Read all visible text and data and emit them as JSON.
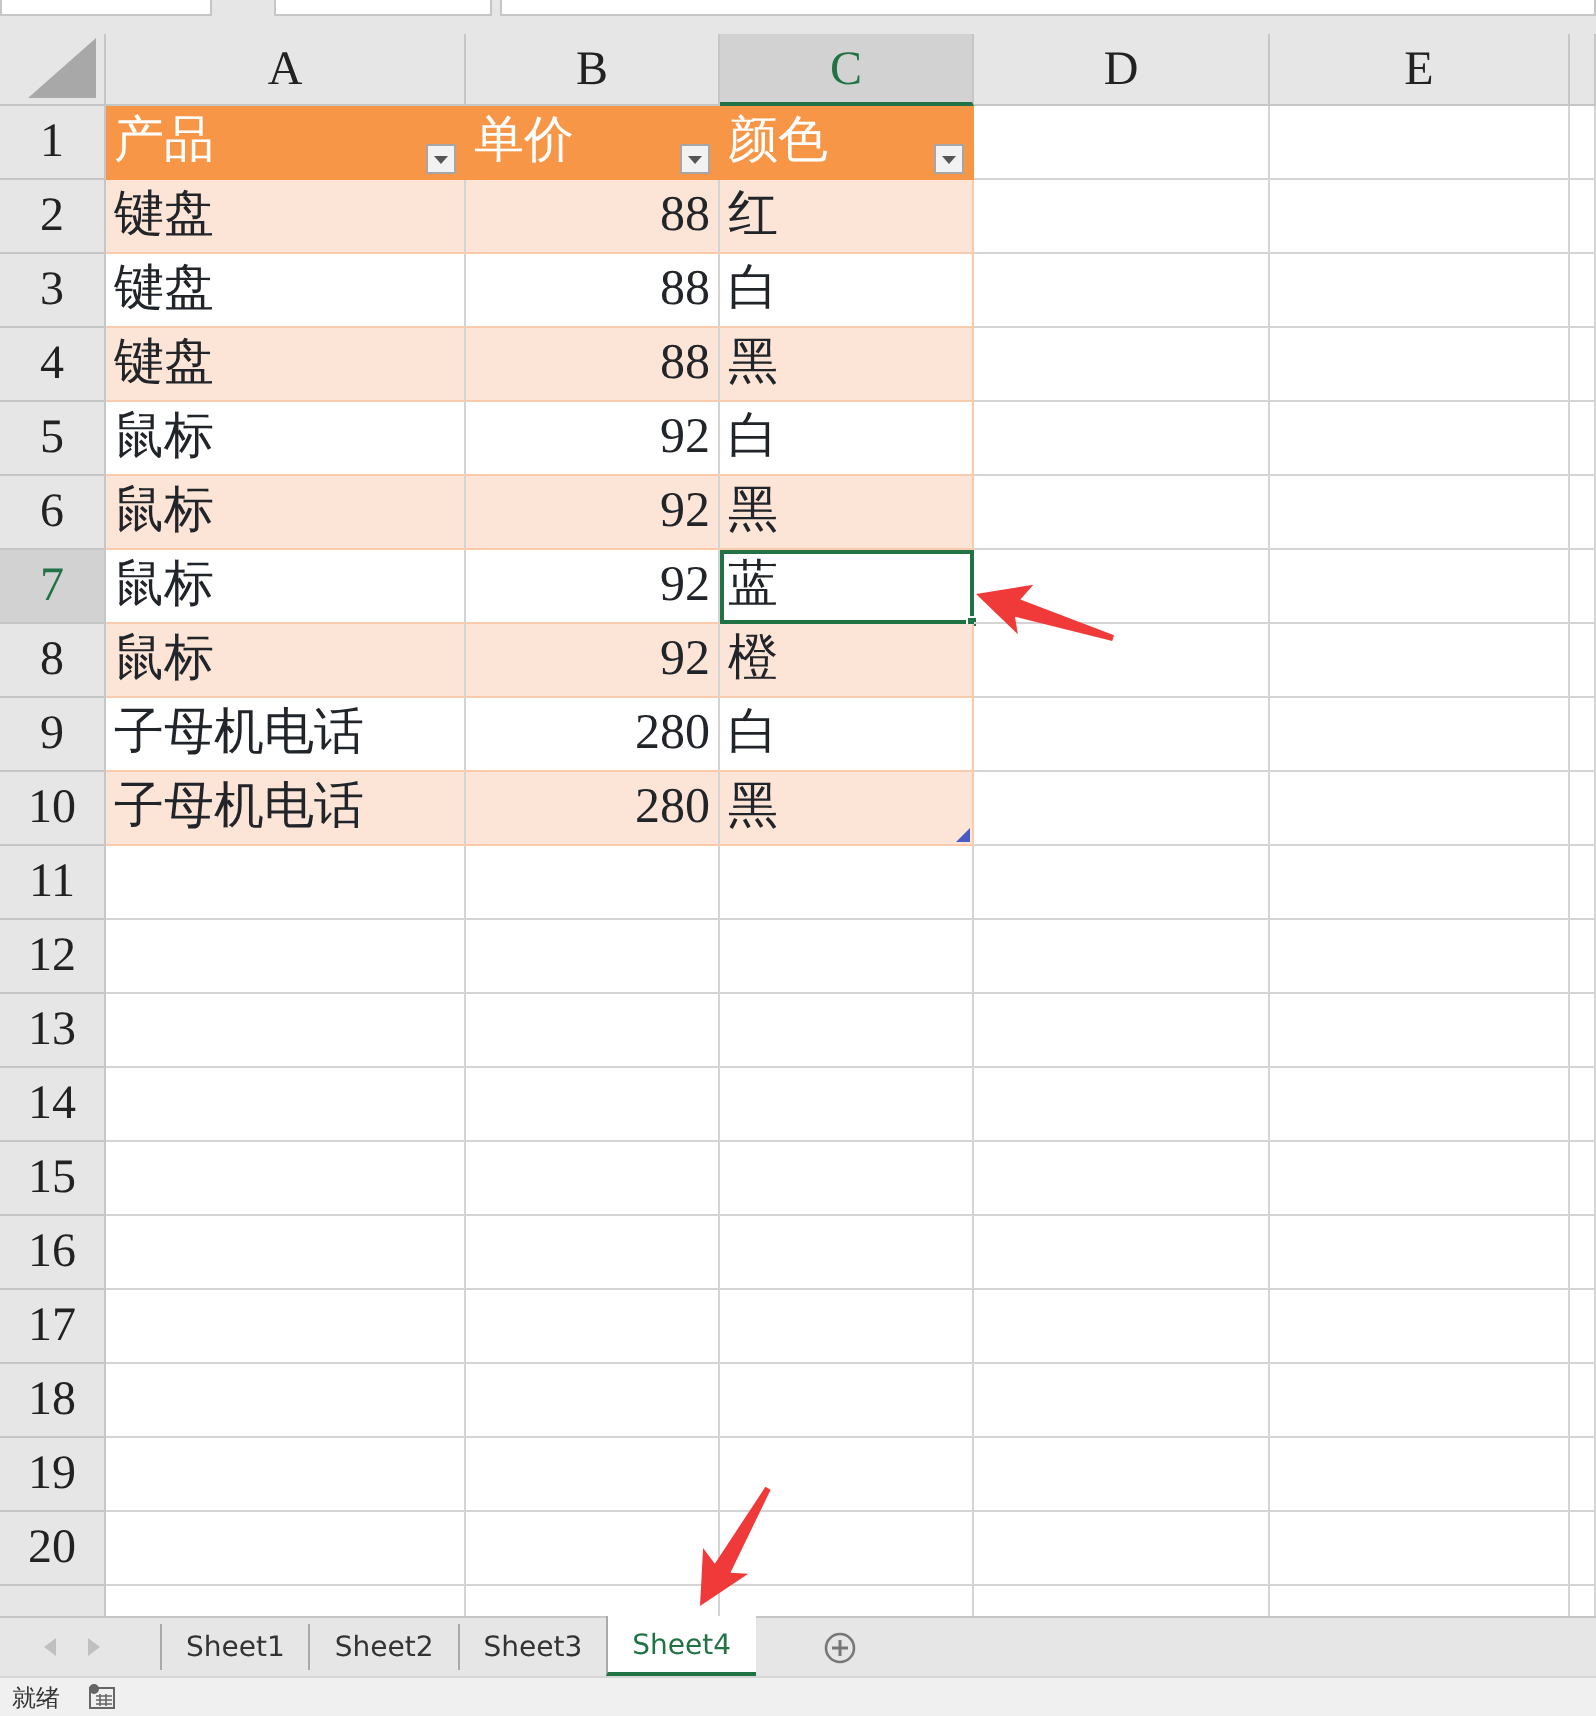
{
  "columns": [
    {
      "label": "A",
      "selected": false
    },
    {
      "label": "B",
      "selected": false
    },
    {
      "label": "C",
      "selected": true
    },
    {
      "label": "D",
      "selected": false
    },
    {
      "label": "E",
      "selected": false
    }
  ],
  "rows": [
    {
      "number": "1",
      "selected": false
    },
    {
      "number": "2",
      "selected": false
    },
    {
      "number": "3",
      "selected": false
    },
    {
      "number": "4",
      "selected": false
    },
    {
      "number": "5",
      "selected": false
    },
    {
      "number": "6",
      "selected": false
    },
    {
      "number": "7",
      "selected": true
    },
    {
      "number": "8",
      "selected": false
    },
    {
      "number": "9",
      "selected": false
    },
    {
      "number": "10",
      "selected": false
    },
    {
      "number": "11",
      "selected": false
    },
    {
      "number": "12",
      "selected": false
    },
    {
      "number": "13",
      "selected": false
    },
    {
      "number": "14",
      "selected": false
    },
    {
      "number": "15",
      "selected": false
    },
    {
      "number": "16",
      "selected": false
    },
    {
      "number": "17",
      "selected": false
    },
    {
      "number": "18",
      "selected": false
    },
    {
      "number": "19",
      "selected": false
    },
    {
      "number": "20",
      "selected": false
    }
  ],
  "table": {
    "banded_rows": true,
    "header": [
      {
        "label": "产品",
        "kind": "text"
      },
      {
        "label": "单价",
        "kind": "number"
      },
      {
        "label": "颜色",
        "kind": "text"
      }
    ],
    "rows": [
      [
        "键盘",
        "88",
        "红"
      ],
      [
        "键盘",
        "88",
        "白"
      ],
      [
        "键盘",
        "88",
        "黑"
      ],
      [
        "鼠标",
        "92",
        "白"
      ],
      [
        "鼠标",
        "92",
        "黑"
      ],
      [
        "鼠标",
        "92",
        "蓝"
      ],
      [
        "鼠标",
        "92",
        "橙"
      ],
      [
        "子母机电话",
        "280",
        "白"
      ],
      [
        "子母机电话",
        "280",
        "黑"
      ]
    ]
  },
  "sheet_tabs": [
    {
      "label": "Sheet1",
      "selected": false
    },
    {
      "label": "Sheet2",
      "selected": false
    },
    {
      "label": "Sheet3",
      "selected": false
    },
    {
      "label": "Sheet4",
      "selected": true
    }
  ],
  "status_bar": {
    "text": "就绪"
  }
}
